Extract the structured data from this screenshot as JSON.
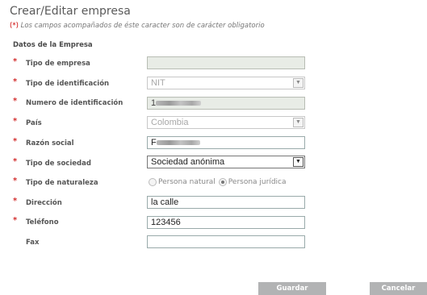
{
  "header": {
    "title": "Crear/Editar empresa",
    "note_marker": "(*)",
    "note_text": " Los campos acompañados de éste caracter son de carácter obligatorio",
    "section_title": "Datos de la Empresa"
  },
  "required_marker": "*",
  "fields": {
    "tipo_empresa": {
      "label": "Tipo de empresa",
      "value": ""
    },
    "tipo_identificacion": {
      "label": "Tipo de identificación",
      "value": "NIT"
    },
    "numero_identificacion": {
      "label": "Numero de identificación",
      "value_prefix": "1"
    },
    "pais": {
      "label": "País",
      "value": "Colombia"
    },
    "razon_social": {
      "label": "Razón social",
      "value_prefix": "F"
    },
    "tipo_sociedad": {
      "label": "Tipo de sociedad",
      "value": "Sociedad anónima"
    },
    "tipo_naturaleza": {
      "label": "Tipo de naturaleza",
      "option_natural": "Persona natural",
      "option_juridica": "Persona jurídica",
      "selected": "Persona jurídica"
    },
    "direccion": {
      "label": "Dirección",
      "value": "la calle"
    },
    "telefono": {
      "label": "Teléfono",
      "value": "123456"
    },
    "fax": {
      "label": "Fax",
      "value": ""
    }
  },
  "icons": {
    "dropdown": "chevron-down-icon"
  },
  "buttons": {
    "save": "Guardar",
    "cancel": "Cancelar"
  },
  "colors": {
    "required": "#d32f2f",
    "button_bg": "#b2b3b4",
    "readonly_bg": "#e8ece6"
  }
}
